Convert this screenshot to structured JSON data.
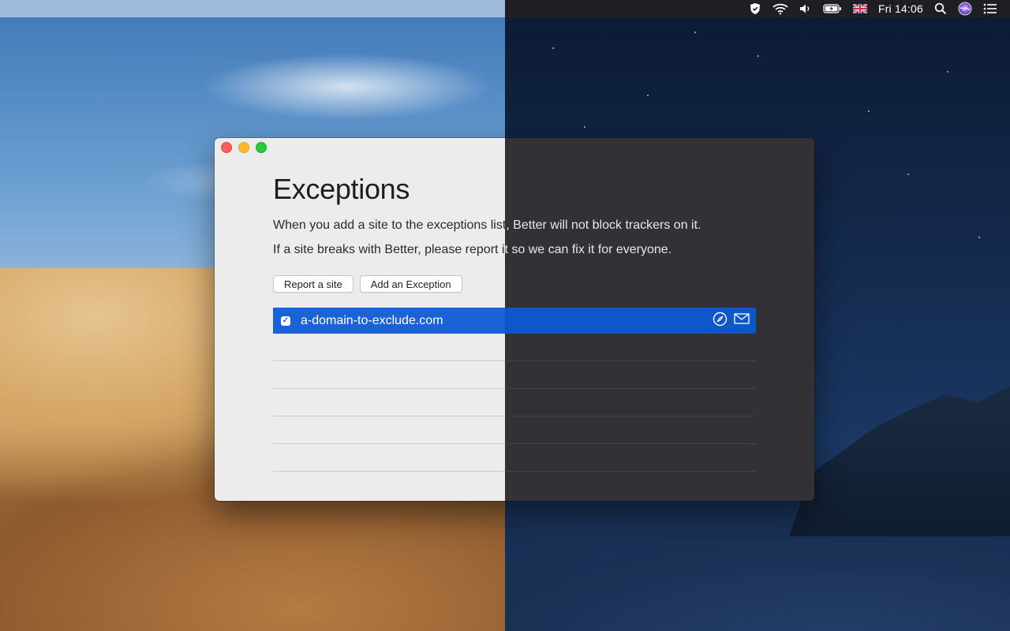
{
  "menubar": {
    "clock": "Fri 14:06",
    "icons": [
      "better-shield-icon",
      "wifi-icon",
      "volume-icon",
      "battery-charging-icon",
      "uk-flag-icon",
      "spotlight-search-icon",
      "siri-icon",
      "notification-center-icon"
    ]
  },
  "window": {
    "title": "Exceptions",
    "description_line1_light": "When you add a site to the exceptions list",
    "description_line1_dark": ", Better will not block trackers on it.",
    "description_line2_light": "If a site breaks with Better, please report i",
    "description_line2_dark": "t so we can fix it for everyone.",
    "buttons": {
      "report": "Report a site",
      "add": "Add an Exception"
    },
    "exceptions": [
      {
        "domain": "a-domain-to-exclude.com",
        "checked": true,
        "selected": true
      }
    ],
    "empty_rows": 5
  },
  "colors": {
    "selection": "#1a63d6",
    "window_light": "#ececec",
    "window_dark": "#323236"
  }
}
